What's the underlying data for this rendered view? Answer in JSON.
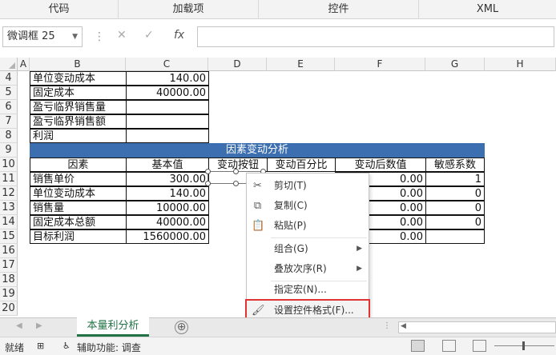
{
  "ribbon": {
    "groups": [
      "代码",
      "加载项",
      "控件",
      "XML"
    ]
  },
  "formula_bar": {
    "name_box": "微调框 25",
    "formula": ""
  },
  "columns": [
    "A",
    "B",
    "C",
    "D",
    "E",
    "F",
    "G",
    "H"
  ],
  "rows": [
    "4",
    "5",
    "6",
    "7",
    "8",
    "9",
    "10",
    "11",
    "12",
    "13",
    "14",
    "15",
    "16",
    "17",
    "18",
    "19",
    "20"
  ],
  "top_table": [
    {
      "label": "单位变动成本",
      "value": "140.00"
    },
    {
      "label": "固定成本",
      "value": "40000.00"
    },
    {
      "label": "盈亏临界销售量",
      "value": ""
    },
    {
      "label": "盈亏临界销售额",
      "value": ""
    },
    {
      "label": "利润",
      "value": ""
    }
  ],
  "factor_table": {
    "banner": "因素变动分析",
    "headers": [
      "因素",
      "基本值",
      "变动按钮",
      "变动百分比",
      "变动后数值",
      "敏感系数"
    ],
    "rows": [
      {
        "factor": "销售单价",
        "base": "300.00",
        "after": "0.00",
        "sens": "1"
      },
      {
        "factor": "单位变动成本",
        "base": "140.00",
        "after": "0.00",
        "sens": "0"
      },
      {
        "factor": "销售量",
        "base": "10000.00",
        "after": "0.00",
        "sens": "0"
      },
      {
        "factor": "固定成本总额",
        "base": "40000.00",
        "after": "0.00",
        "sens": "0"
      },
      {
        "factor": "目标利润",
        "base": "1560000.00",
        "after": "0.00",
        "sens": ""
      }
    ]
  },
  "context_menu": {
    "items": [
      {
        "label": "剪切(T)",
        "icon": "scissors-icon"
      },
      {
        "label": "复制(C)",
        "icon": "copy-icon"
      },
      {
        "label": "粘贴(P)",
        "icon": "paste-icon"
      },
      {
        "label": "组合(G)",
        "submenu": true
      },
      {
        "label": "叠放次序(R)",
        "submenu": true
      },
      {
        "label": "指定宏(N)..."
      },
      {
        "label": "设置控件格式(F)...",
        "icon": "format-control-icon",
        "highlighted": true
      }
    ]
  },
  "sheet_tabs": {
    "active": "本量利分析",
    "add": "⊕"
  },
  "status_bar": {
    "mode": "就绪",
    "accessibility": "辅助功能: 调查"
  },
  "colors": {
    "banner": "#3c6fb0",
    "sheet_tab_accent": "#217346",
    "highlight_border": "#e03434"
  }
}
